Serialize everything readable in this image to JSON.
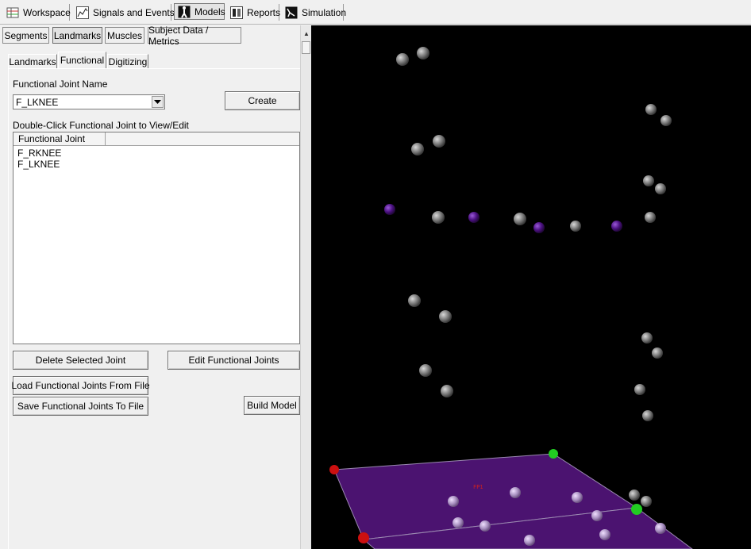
{
  "toolbar": {
    "items": [
      {
        "label": "Workspace",
        "icon": "workspace-icon"
      },
      {
        "label": "Signals and Events",
        "icon": "signals-icon"
      },
      {
        "label": "Models",
        "icon": "models-icon",
        "active": true
      },
      {
        "label": "Reports",
        "icon": "reports-icon"
      },
      {
        "label": "Simulation",
        "icon": "simulation-icon"
      }
    ]
  },
  "tabs": {
    "main": [
      "Segments",
      "Landmarks",
      "Muscles",
      "Subject Data / Metrics"
    ],
    "main_selected": "Landmarks",
    "sub": [
      "Landmarks",
      "Functional",
      "Digitizing"
    ],
    "sub_selected": "Functional"
  },
  "functional": {
    "joint_name_label": "Functional Joint Name",
    "joint_name_value": "F_LKNEE",
    "create_button": "Create",
    "list_label": "Double-Click Functional Joint to View/Edit",
    "list_header": "Functional Joint",
    "joints": [
      "F_RKNEE",
      "F_LKNEE"
    ],
    "delete_button": "Delete Selected Joint",
    "edit_button": "Edit Functional Joints",
    "load_button": "Load Functional Joints From File",
    "save_button": "Save Functional Joints To File",
    "build_button": "Build Model"
  },
  "viewport": {
    "background": "#000000",
    "marker_color": "#8a8a8a",
    "purple_marker_color": "#5a1a8a",
    "plate_color": "#4b1370",
    "plate_corner_red": "#cc1010",
    "plate_corner_green": "#22cc22"
  }
}
